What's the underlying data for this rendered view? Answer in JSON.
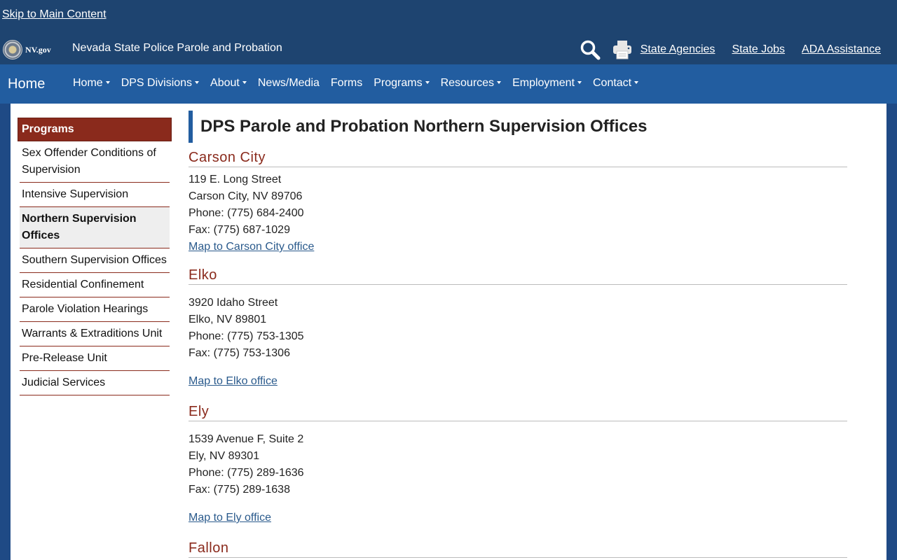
{
  "skip_link": "Skip to Main Content",
  "header": {
    "logo_text": "NV.gov",
    "agency_title": "Nevada State Police Parole and Probation",
    "links": [
      "State Agencies",
      "State Jobs",
      "ADA Assistance"
    ]
  },
  "nav": {
    "home": "Home",
    "items": [
      {
        "label": "Home",
        "dropdown": true
      },
      {
        "label": "DPS Divisions",
        "dropdown": true
      },
      {
        "label": "About",
        "dropdown": true
      },
      {
        "label": "News/Media",
        "dropdown": false
      },
      {
        "label": "Forms",
        "dropdown": false
      },
      {
        "label": "Programs",
        "dropdown": true
      },
      {
        "label": "Resources",
        "dropdown": true
      },
      {
        "label": "Employment",
        "dropdown": true
      },
      {
        "label": "Contact",
        "dropdown": true
      }
    ]
  },
  "sidebar": {
    "header": "Programs",
    "items": [
      {
        "label": "Sex Offender Conditions of Supervision",
        "active": false
      },
      {
        "label": "Intensive Supervision",
        "active": false
      },
      {
        "label": "Northern Supervision Offices",
        "active": true
      },
      {
        "label": "Southern Supervision Offices",
        "active": false
      },
      {
        "label": "Residential Confinement",
        "active": false
      },
      {
        "label": "Parole Violation Hearings",
        "active": false
      },
      {
        "label": "Warrants & Extraditions Unit",
        "active": false
      },
      {
        "label": "Pre-Release Unit",
        "active": false
      },
      {
        "label": "Judicial Services",
        "active": false
      }
    ]
  },
  "main": {
    "title": "DPS Parole and Probation Northern Supervision Offices",
    "offices": [
      {
        "name": "Carson City",
        "lines": [
          "119 E. Long Street",
          "Carson City, NV 89706",
          "Phone: (775) 684-2400",
          "Fax: (775) 687-1029"
        ],
        "map_link": "Map to Carson City office"
      },
      {
        "name": "Elko",
        "lines": [
          "3920 Idaho Street",
          "Elko, NV 89801",
          "Phone: (775) 753-1305",
          "Fax: (775) 753-1306"
        ],
        "map_link": "Map to Elko office"
      },
      {
        "name": "Ely",
        "lines": [
          "1539 Avenue F, Suite 2",
          "Ely, NV 89301",
          "Phone: (775) 289-1636",
          "Fax: (775) 289-1638"
        ],
        "map_link": "Map to Ely office"
      },
      {
        "name": "Fallon",
        "lines": [],
        "map_link": ""
      }
    ]
  },
  "icons": {
    "search": "search-icon",
    "print": "print-icon",
    "seal": "nevada-seal-icon"
  },
  "colors": {
    "header_bg": "#1e4470",
    "nav_bg": "#225da0",
    "accent_red": "#8a2a1c",
    "link": "#2a5a8c"
  }
}
